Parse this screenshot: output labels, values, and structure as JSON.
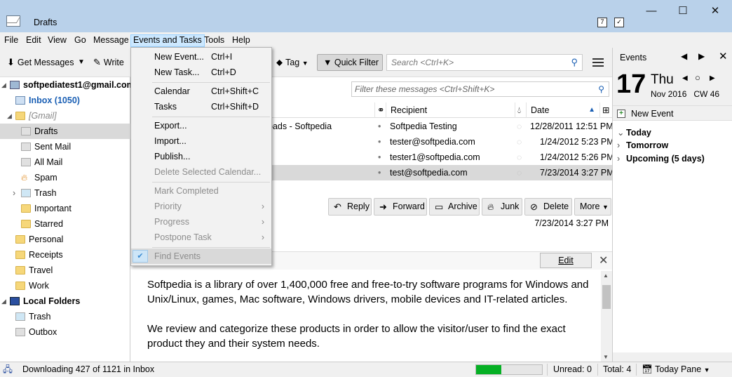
{
  "window": {
    "title": "Drafts",
    "controls": {
      "minimize": "—",
      "maximize": "☐",
      "close": "✕"
    }
  },
  "menubar": [
    "File",
    "Edit",
    "View",
    "Go",
    "Message",
    "Events and Tasks",
    "Tools",
    "Help"
  ],
  "toolbar": {
    "get_messages": "Get Messages",
    "write": "Write",
    "tag": "Tag",
    "quick_filter": "Quick Filter",
    "search_placeholder": "Search <Ctrl+K>"
  },
  "folders": {
    "account": "softpediatest1@gmail.com",
    "inbox": "Inbox (1050)",
    "gmail": "[Gmail]",
    "drafts": "Drafts",
    "sent": "Sent Mail",
    "all": "All Mail",
    "spam": "Spam",
    "trash": "Trash",
    "important": "Important",
    "starred": "Starred",
    "personal": "Personal",
    "receipts": "Receipts",
    "travel": "Travel",
    "work": "Work",
    "local": "Local Folders",
    "local_trash": "Trash",
    "outbox": "Outbox"
  },
  "messages": {
    "filter_placeholder": "Filter these messages <Ctrl+Shift+K>",
    "columns": {
      "recipient": "Recipient",
      "date": "Date"
    },
    "rows": [
      {
        "subject": "oads - Softpedia",
        "recipient": "Softpedia Testing",
        "date": "12/28/2011 12:51 PM"
      },
      {
        "subject": "",
        "recipient": "tester@softpedia.com",
        "date": "1/24/2012 5:23 PM"
      },
      {
        "subject": "",
        "recipient": "tester1@softpedia.com",
        "date": "1/24/2012 5:26 PM"
      },
      {
        "subject": "t",
        "recipient": "test@softpedia.com",
        "date": "7/23/2014 3:27 PM"
      }
    ]
  },
  "message_header": {
    "reply": "Reply",
    "forward": "Forward",
    "archive": "Archive",
    "junk": "Junk",
    "delete": "Delete",
    "more": "More",
    "date": "7/23/2014 3:27 PM"
  },
  "compose": {
    "edit": "Edit",
    "para1": "Softpedia is a library of over 1,400,000 free and free-to-try software programs for Windows and Unix/Linux, games, Mac software, Windows drivers, mobile devices and IT-related articles.",
    "para2": "We review and categorize these products in order to allow the visitor/user to find the exact product they and their system needs."
  },
  "today_pane": {
    "title": "Events",
    "day_number": "17",
    "day_name": "Thu",
    "month_year": "Nov 2016",
    "week": "CW 46",
    "new_event": "New Event",
    "sections": [
      "Today",
      "Tomorrow",
      "Upcoming (5 days)"
    ]
  },
  "menu_events": {
    "new_event": {
      "label": "New Event...",
      "accel": "Ctrl+I"
    },
    "new_task": {
      "label": "New Task...",
      "accel": "Ctrl+D"
    },
    "calendar": {
      "label": "Calendar",
      "accel": "Ctrl+Shift+C"
    },
    "tasks": {
      "label": "Tasks",
      "accel": "Ctrl+Shift+D"
    },
    "export": "Export...",
    "import": "Import...",
    "publish": "Publish...",
    "delete_cal": "Delete Selected Calendar...",
    "mark_completed": "Mark Completed",
    "priority": "Priority",
    "progress": "Progress",
    "postpone": "Postpone Task",
    "find_events": "Find Events"
  },
  "statusbar": {
    "downloading": "Downloading 427 of 1121 in Inbox",
    "progress_fraction": 0.38,
    "unread": "Unread: 0",
    "total": "Total: 4",
    "today_pane": "Today Pane"
  },
  "colors": {
    "accent": "#1a5fb4",
    "titlebar": "#b9d1ea",
    "progress": "#06b025"
  }
}
